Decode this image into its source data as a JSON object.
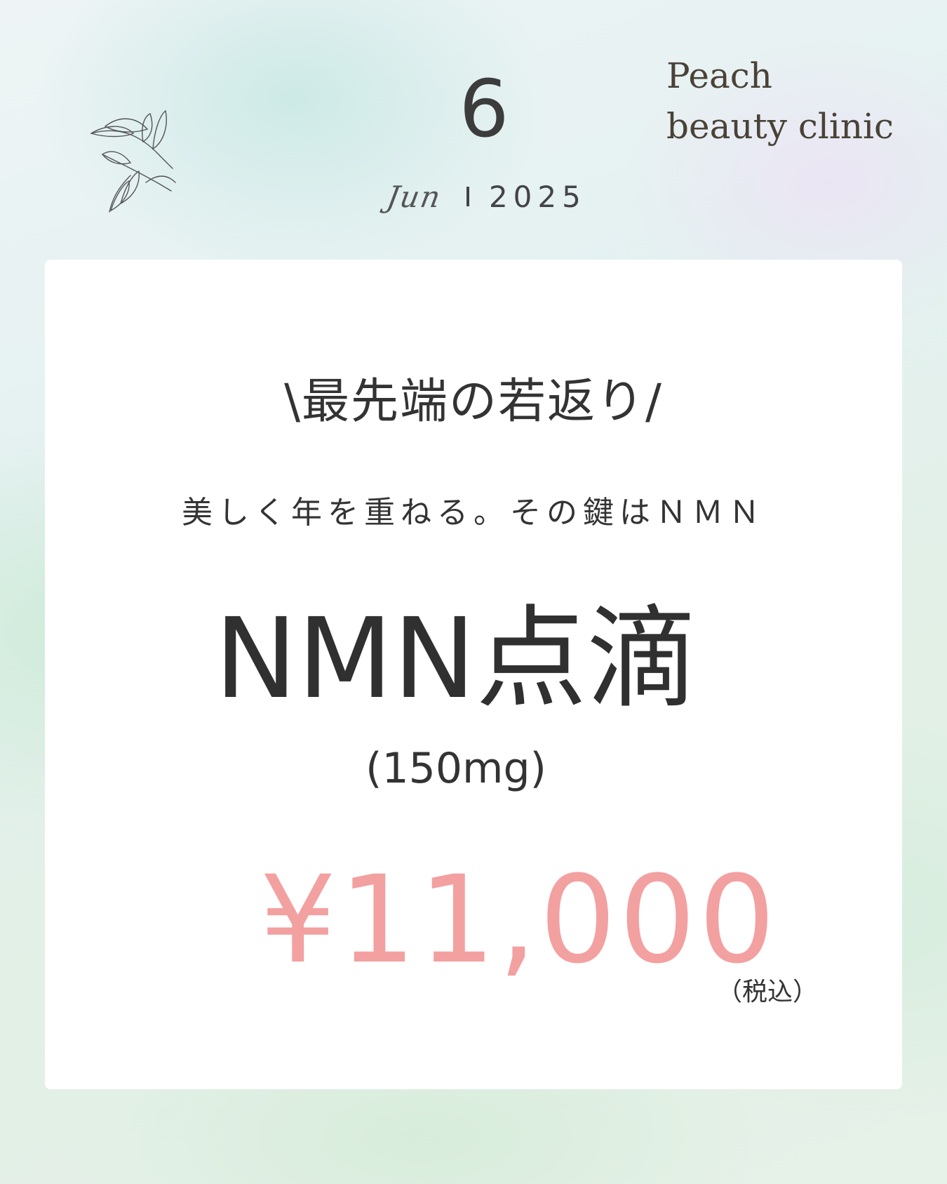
{
  "date": {
    "day": "6",
    "month": "Jun",
    "year": "2025"
  },
  "brand": {
    "line1": "Peach",
    "line2": "beauty clinic"
  },
  "card": {
    "headline": "\\最先端の若返り/",
    "subline": "美しく年を重ねる。その鍵はＮＭＮ",
    "product_name": "NMN点滴",
    "dose": "(150mg)",
    "price": "¥11,000",
    "tax_note": "（税込）"
  },
  "colors": {
    "price": "#f3a0a0",
    "text": "#333333",
    "brand": "#4a4237"
  },
  "icons": [
    "leaf-branch-icon"
  ]
}
